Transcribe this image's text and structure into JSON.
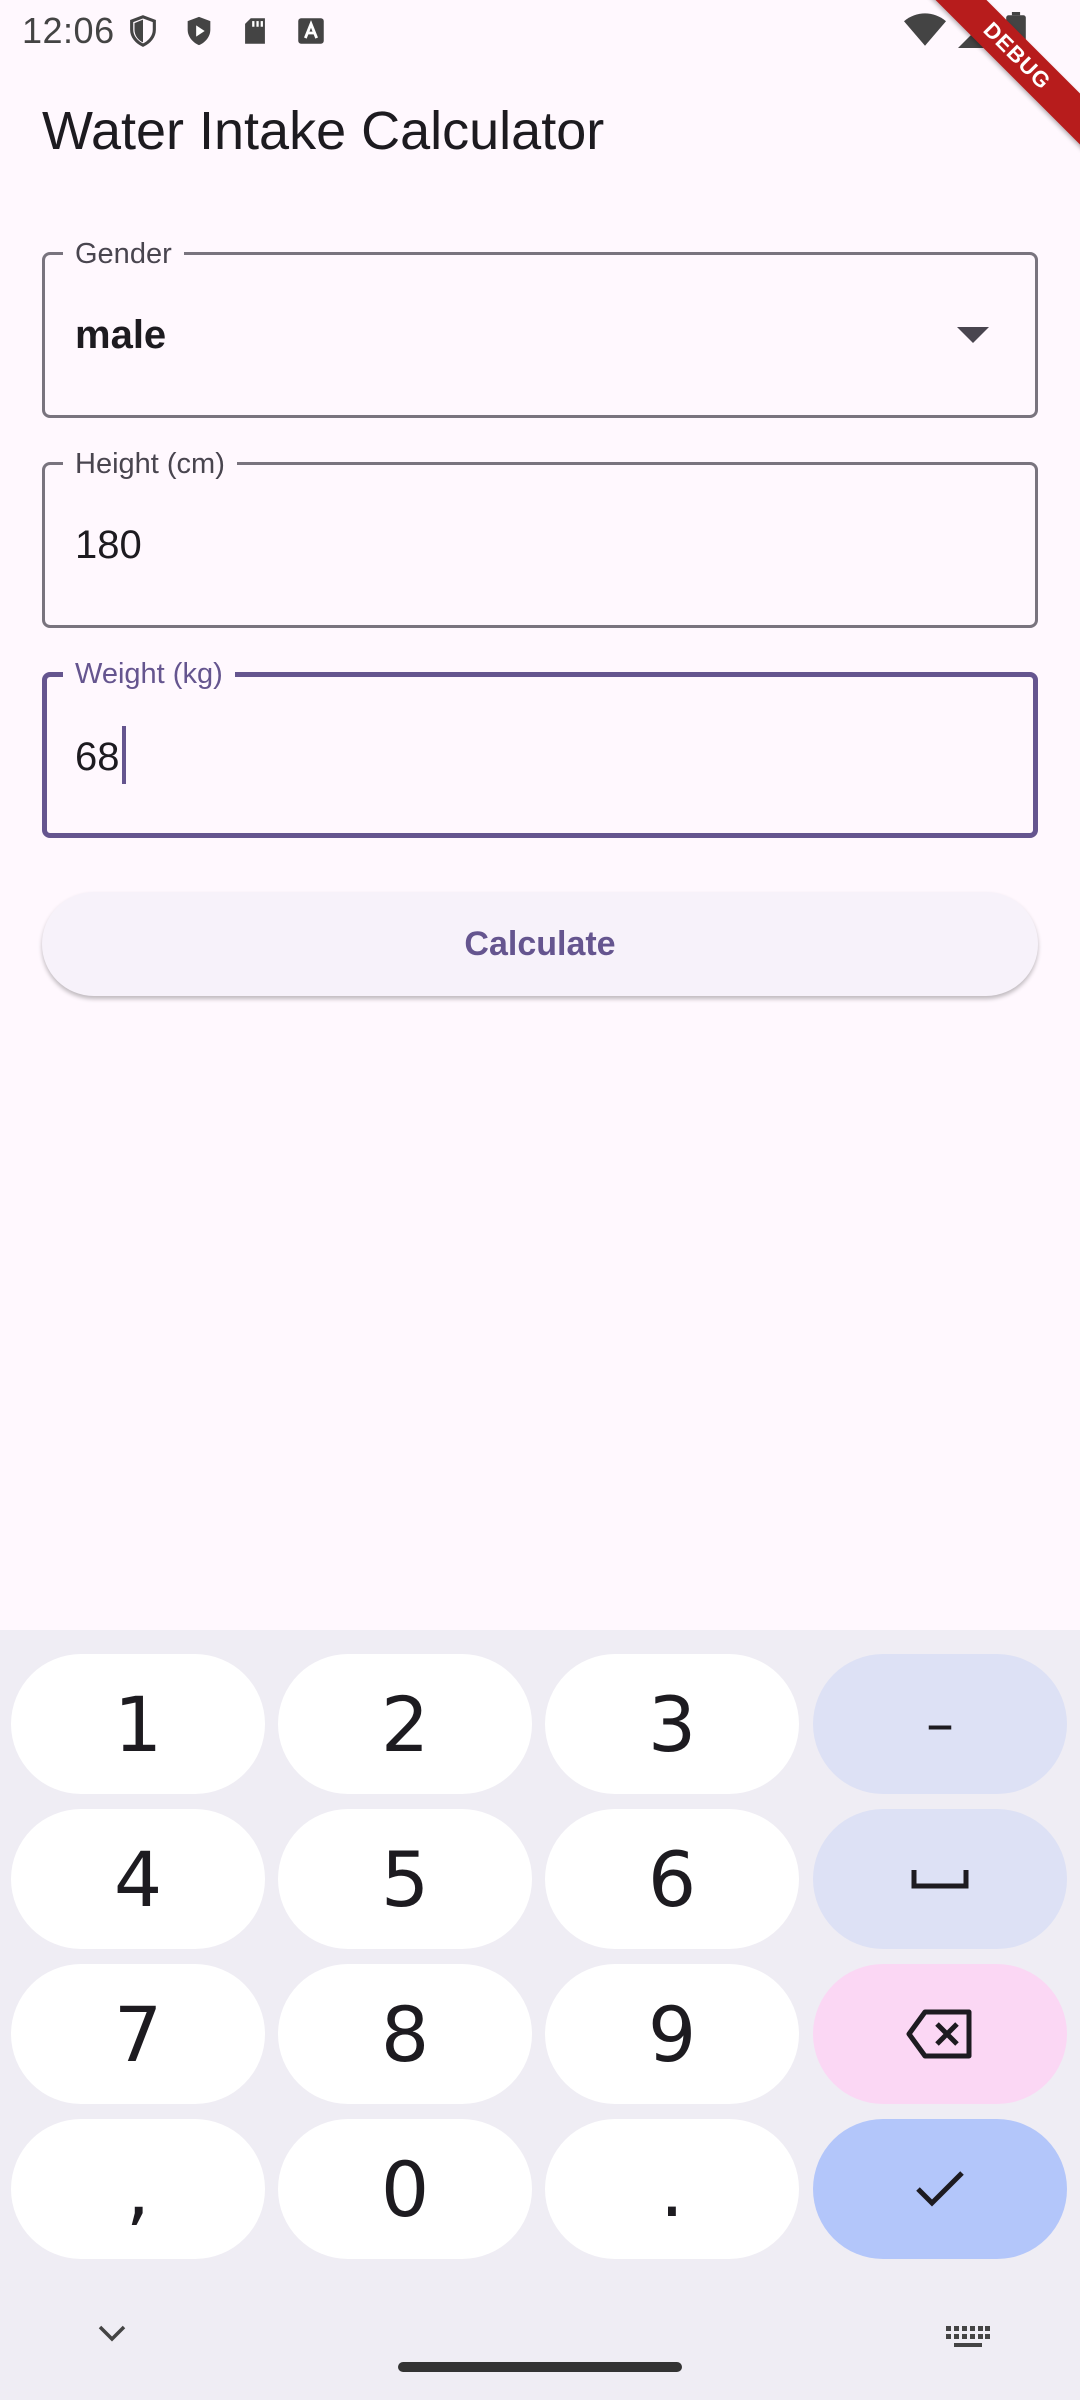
{
  "status_bar": {
    "time": "12:06",
    "left_icons": [
      "shield-icon",
      "play-protect-icon",
      "sd-card-icon",
      "font-icon"
    ],
    "right_icons": [
      "wifi-icon",
      "signal-icon",
      "battery-icon"
    ]
  },
  "debug_banner": "DEBUG",
  "app_bar": {
    "title": "Water Intake Calculator"
  },
  "form": {
    "gender": {
      "label": "Gender",
      "value": "male"
    },
    "height": {
      "label": "Height (cm)",
      "value": "180"
    },
    "weight": {
      "label": "Weight (kg)",
      "value": "68"
    },
    "calculate_label": "Calculate"
  },
  "keyboard": {
    "rows": [
      [
        "1",
        "2",
        "3",
        "–"
      ],
      [
        "4",
        "5",
        "6",
        "space"
      ],
      [
        "7",
        "8",
        "9",
        "backspace"
      ],
      [
        ",",
        "0",
        ".",
        "done"
      ]
    ],
    "keys": {
      "k1": "1",
      "k2": "2",
      "k3": "3",
      "minus": "–",
      "k4": "4",
      "k5": "5",
      "k6": "6",
      "k7": "7",
      "k8": "8",
      "k9": "9",
      "comma": ",",
      "k0": "0",
      "period": "."
    },
    "icons": [
      "space-icon",
      "backspace-icon",
      "check-icon",
      "chevron-down-icon",
      "keyboard-icon"
    ]
  },
  "colors": {
    "primary": "#65558F",
    "background": "#FFF8FE",
    "outline": "#79747E",
    "keyboard_bg": "#EFEDF4",
    "key_func": "#DDE1F5",
    "key_delete": "#FBD7F4",
    "key_enter": "#B3C6FA",
    "debug_banner": "#B71C1C"
  }
}
